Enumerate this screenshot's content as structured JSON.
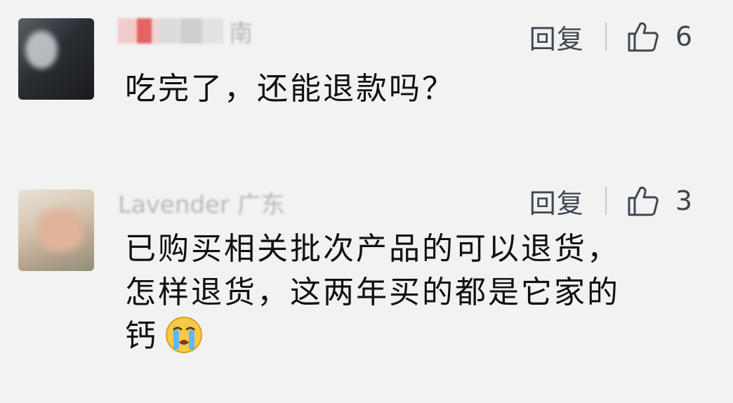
{
  "comments": [
    {
      "username_visible": "南",
      "reply_label": "回复",
      "like_count": "6",
      "text": "吃完了，还能退款吗？"
    },
    {
      "username_visible": "Lavender 广东",
      "reply_label": "回复",
      "like_count": "3",
      "text_lines": [
        "已购买相关批次产品的可以退货，",
        "怎样退货，这两年买的都是它家的",
        "钙"
      ],
      "emoji": "crying-face-icon"
    }
  ],
  "colors": {
    "background": "#f2f2f2",
    "action_text": "#3f4753",
    "body_text": "#111111"
  }
}
